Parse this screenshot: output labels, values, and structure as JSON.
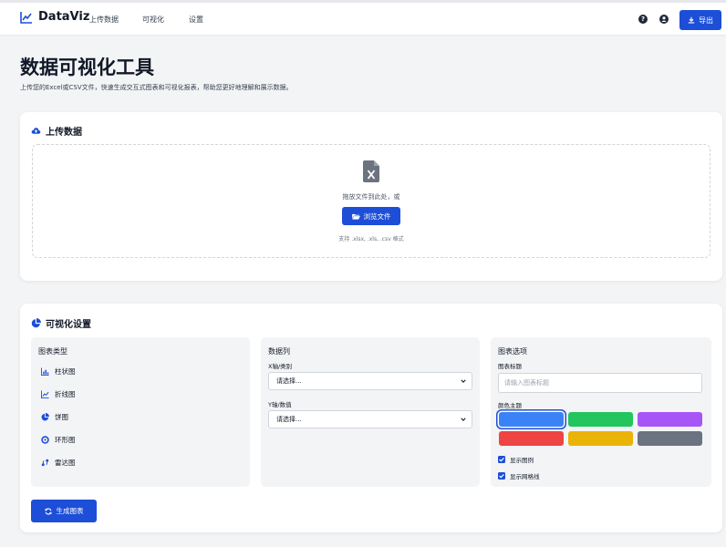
{
  "header": {
    "brand": "DataViz",
    "nav": [
      "上传数据",
      "可视化",
      "设置"
    ],
    "help_icon": "question-circle-icon",
    "user_icon": "user-circle-icon",
    "export_label": "导出"
  },
  "page": {
    "title": "数据可视化工具",
    "subtitle": "上传您的Excel或CSV文件，快速生成交互式图表和可视化报表，帮助您更好地理解和展示数据。"
  },
  "upload": {
    "title": "上传数据",
    "drop_text": "拖放文件到此处，或",
    "browse_label": "浏览文件",
    "support_text": "支持 .xlsx, .xls, .csv 格式"
  },
  "viz": {
    "title": "可视化设置",
    "chart_types_title": "图表类型",
    "chart_types": [
      {
        "label": "柱状图",
        "icon": "bar-chart-icon"
      },
      {
        "label": "折线图",
        "icon": "line-chart-icon"
      },
      {
        "label": "饼图",
        "icon": "pie-chart-icon"
      },
      {
        "label": "环形图",
        "icon": "donut-chart-icon"
      },
      {
        "label": "雷达图",
        "icon": "radar-chart-icon"
      }
    ],
    "columns_title": "数据列",
    "x_label": "X轴/类别",
    "x_value": "请选择...",
    "y_label": "Y轴/数值",
    "y_value": "请选择...",
    "options_title": "图表选项",
    "chart_title_label": "图表标题",
    "chart_title_placeholder": "请输入图表标题",
    "theme_label": "颜色主题",
    "themes": [
      "#3b82f6",
      "#22c55e",
      "#a855f7",
      "#ef4444",
      "#eab308",
      "#6b7280"
    ],
    "selected_theme": 0,
    "show_legend": "显示图例",
    "show_grid": "显示网格线",
    "generate_label": "生成图表"
  },
  "colors": {
    "accent": "#1d4ed8",
    "background": "#f3f4f6"
  }
}
